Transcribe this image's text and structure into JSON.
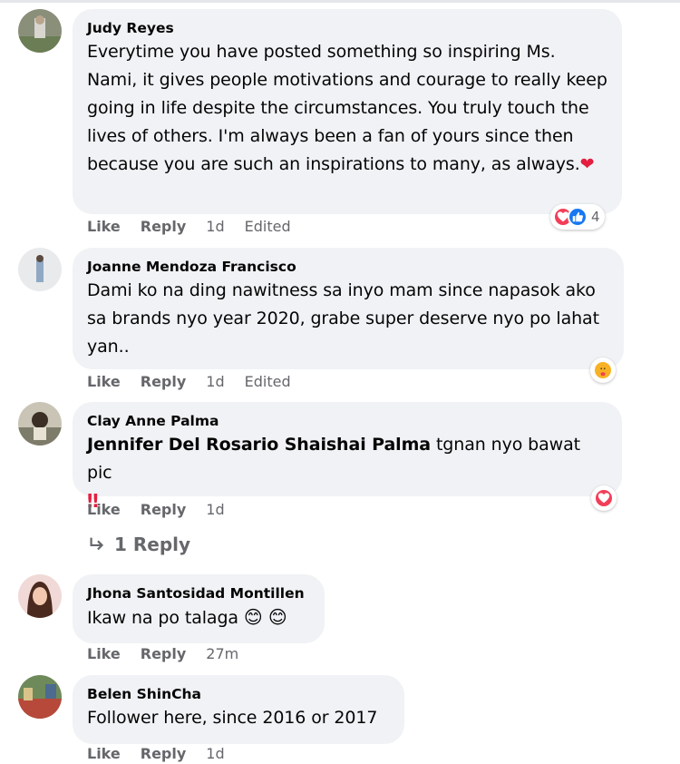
{
  "comments": [
    {
      "author": "Judy Reyes",
      "text": "Everytime you have posted something so inspiring Ms. Nami, it gives people motivations and courage to really keep going in life despite the circumstances. You truly touch the lives of others. I'm always been a fan of yours since then because you are such an inspirations to many, as always.",
      "like_label": "Like",
      "reply_label": "Reply",
      "time": "1d",
      "edited": "Edited",
      "reaction_count": "4",
      "reactions": [
        "love-reaction-icon",
        "like-reaction-icon"
      ]
    },
    {
      "author": "Joanne Mendoza Francisco",
      "text": "Dami ko na ding nawitness sa inyo mam since napasok ako sa brands nyo year 2020, grabe super deserve nyo po lahat yan..",
      "like_label": "Like",
      "reply_label": "Reply",
      "time": "1d",
      "edited": "Edited",
      "reactions": [
        "care-reaction-icon"
      ]
    },
    {
      "author": "Clay Anne Palma",
      "tag": "Jennifer Del Rosario Shaishai Palma",
      "text": " tgnan nyo bawat pic",
      "emphasis": "‼",
      "like_label": "Like",
      "reply_label": "Reply",
      "time": "1d",
      "reactions": [
        "love-reaction-icon"
      ],
      "replies_label": "1 Reply"
    },
    {
      "author": "Jhona Santosidad Montillen",
      "text": "Ikaw na po talaga",
      "emojis": "😊 😊",
      "like_label": "Like",
      "reply_label": "Reply",
      "time": "27m"
    },
    {
      "author": "Belen ShinCha",
      "text": "Follower here, since 2016 or 2017",
      "like_label": "Like",
      "reply_label": "Reply",
      "time": "1d"
    }
  ],
  "colors": {
    "bubble": "#f0f2f5",
    "meta_text": "#65676b",
    "love": "#f33e58",
    "like": "#1877f2",
    "care": "#f7b125"
  }
}
